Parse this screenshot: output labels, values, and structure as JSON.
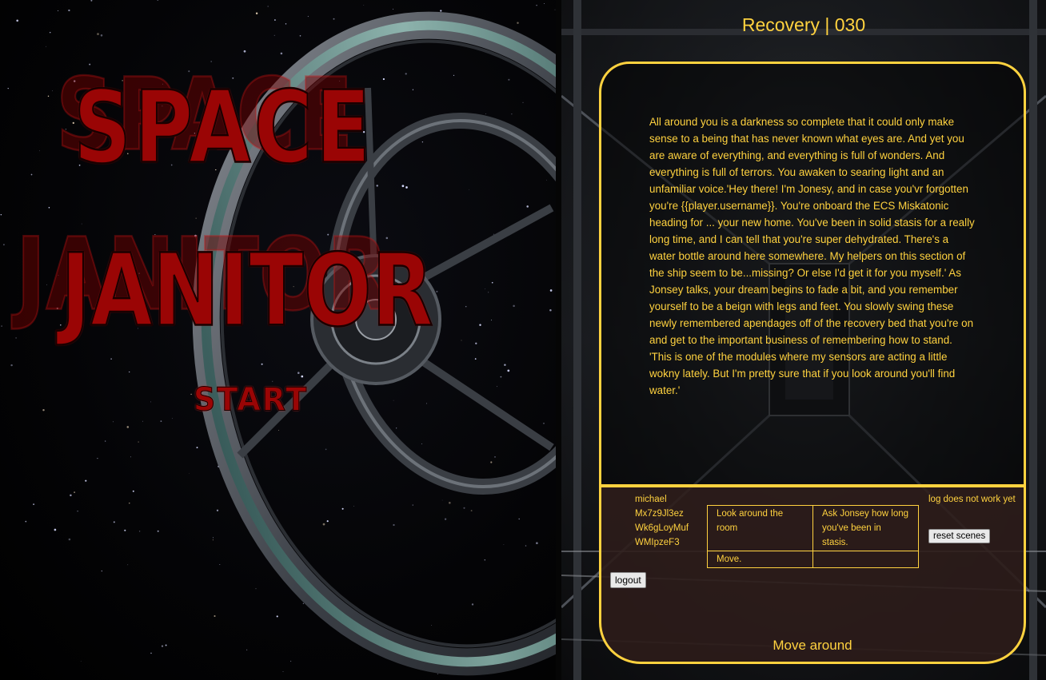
{
  "game": {
    "title_line1": "SPACE",
    "title_line2": "JANITOR",
    "start_label": "START"
  },
  "scene": {
    "title": "Recovery | 030",
    "story": "All around you is a darkness so complete that it could only make sense to a being that has never known what eyes are. And yet you are aware of everything, and everything is full of wonders. And everything is full of terrors. You awaken to searing light and an unfamiliar voice.'Hey there! I'm Jonesy, and in case you'vr forgotten you're {{player.username}}. You're onboard the ECS Miskatonic heading for ... your new home. You've been in solid stasis for a really long time, and I can tell that you're super dehydrated. There's a water bottle around here somewhere. My helpers on this section of the ship seem to be...missing? Or else I'd get it for you myself.' As Jonsey talks, your dream begins to fade a bit, and you remember yourself to be a beign with legs and feet. You slowly swing these newly remembered apendages off of the recovery bed that you're on and get to the important business of remembering how to stand. 'This is one of the modules where my sensors are acting a little wokny lately. But I'm pretty sure that if you look around you'll find water.'"
  },
  "user": {
    "name": "michael",
    "id": "Mx7z9Jl3ezWk6gLoyMufWMIpzeF3",
    "logout_label": "logout"
  },
  "choices": [
    [
      "Look around the room",
      "Ask Jonsey how long you've been in stasis."
    ],
    [
      "Move.",
      ""
    ]
  ],
  "controls": {
    "log_note": "log does not work yet",
    "reset_label": "reset scenes",
    "footer_label": "Move around"
  },
  "colors": {
    "accent": "#ffd23f",
    "title_red": "#9a0505"
  }
}
